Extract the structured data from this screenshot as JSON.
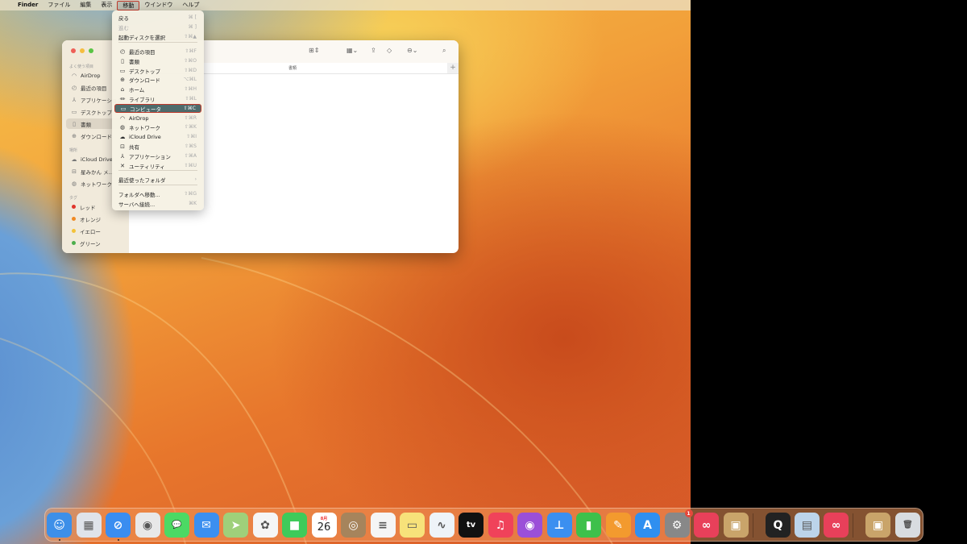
{
  "menubar": {
    "apple": "",
    "app": "Finder",
    "items": [
      "ファイル",
      "編集",
      "表示",
      "移動",
      "ウインドウ",
      "ヘルプ"
    ],
    "active": "移動"
  },
  "menu": {
    "items": [
      {
        "label": "戻る",
        "shortcut": "⌘ [",
        "icon": "",
        "disabled": false
      },
      {
        "label": "進む",
        "shortcut": "⌘ ]",
        "icon": "",
        "disabled": true
      },
      {
        "label": "起動ディスクを選択",
        "shortcut": "⇧⌘▲",
        "icon": "",
        "disabled": false
      },
      {
        "label": "最近の項目",
        "shortcut": "⇧⌘F",
        "icon": "clock-icon"
      },
      {
        "label": "書類",
        "shortcut": "⇧⌘O",
        "icon": "document-icon"
      },
      {
        "label": "デスクトップ",
        "shortcut": "⇧⌘D",
        "icon": "desktop-icon"
      },
      {
        "label": "ダウンロード",
        "shortcut": "⌥⌘L",
        "icon": "download-icon"
      },
      {
        "label": "ホーム",
        "shortcut": "⇧⌘H",
        "icon": "home-icon"
      },
      {
        "label": "ライブラリ",
        "shortcut": "⇧⌘L",
        "icon": "library-icon"
      },
      {
        "label": "コンピュータ",
        "shortcut": "⇧⌘C",
        "icon": "computer-icon",
        "highlighted": true
      },
      {
        "label": "AirDrop",
        "shortcut": "⇧⌘R",
        "icon": "airdrop-icon"
      },
      {
        "label": "ネットワーク",
        "shortcut": "⇧⌘K",
        "icon": "network-icon"
      },
      {
        "label": "iCloud Drive",
        "shortcut": "⇧⌘I",
        "icon": "cloud-icon"
      },
      {
        "label": "共有",
        "shortcut": "⇧⌘S",
        "icon": "shared-folder-icon"
      },
      {
        "label": "アプリケーション",
        "shortcut": "⇧⌘A",
        "icon": "applications-icon"
      },
      {
        "label": "ユーティリティ",
        "shortcut": "⇧⌘U",
        "icon": "utilities-icon"
      },
      {
        "label": "最近使ったフォルダ",
        "shortcut": "›",
        "icon": ""
      },
      {
        "label": "フォルダへ移動...",
        "shortcut": "⇧⌘G",
        "icon": ""
      },
      {
        "label": "サーバへ接続...",
        "shortcut": "⌘K",
        "icon": ""
      }
    ]
  },
  "finder": {
    "column_header": "書類",
    "sidebar": {
      "favorites_title": "よく使う項目",
      "favorites": [
        "AirDrop",
        "最近の項目",
        "アプリケーション",
        "デスクトップ",
        "書類",
        "ダウンロード"
      ],
      "selected": "書類",
      "locations_title": "場所",
      "locations": [
        "iCloud Drive",
        "星みかん メ…",
        "ネットワーク"
      ],
      "tags_title": "タグ",
      "tags": [
        {
          "label": "レッド",
          "color": "#e0352b"
        },
        {
          "label": "オレンジ",
          "color": "#f08a24"
        },
        {
          "label": "イエロー",
          "color": "#f3c23a"
        },
        {
          "label": "グリーン",
          "color": "#4cae4c"
        }
      ]
    }
  },
  "dock": {
    "apps": [
      {
        "name": "Finder",
        "color": "#3d8fe8",
        "glyph": "☺",
        "running": true
      },
      {
        "name": "Launchpad",
        "color": "#dfe3ea",
        "glyph": "▦"
      },
      {
        "name": "Safari",
        "color": "#3a8df0",
        "glyph": "⊘",
        "running": true
      },
      {
        "name": "Chrome",
        "color": "#e8e8e8",
        "glyph": "◉"
      },
      {
        "name": "Messages",
        "color": "#4cd964",
        "glyph": "💬"
      },
      {
        "name": "Mail",
        "color": "#3b8ff0",
        "glyph": "✉"
      },
      {
        "name": "Maps",
        "color": "#9fd07a",
        "glyph": "➤"
      },
      {
        "name": "Photos",
        "color": "#f5f5f5",
        "glyph": "✿"
      },
      {
        "name": "FaceTime",
        "color": "#3ecb5a",
        "glyph": "■"
      },
      {
        "name": "Calendar",
        "color": "#ffffff",
        "glyph": "26",
        "month": "8月"
      },
      {
        "name": "Contacts",
        "color": "#a6845c",
        "glyph": "◎"
      },
      {
        "name": "Reminders",
        "color": "#f5f5f5",
        "glyph": "≡"
      },
      {
        "name": "Notes",
        "color": "#f7e27a",
        "glyph": "▭"
      },
      {
        "name": "Freeform",
        "color": "#eef3f8",
        "glyph": "∿"
      },
      {
        "name": "TV",
        "color": "#111111",
        "glyph": "tv"
      },
      {
        "name": "Music",
        "color": "#f0425a",
        "glyph": "♫"
      },
      {
        "name": "Podcasts",
        "color": "#9b4fd8",
        "glyph": "◉"
      },
      {
        "name": "Keynote",
        "color": "#3b8ff0",
        "glyph": "⊥"
      },
      {
        "name": "Numbers",
        "color": "#3ec04b",
        "glyph": "▮"
      },
      {
        "name": "Pages",
        "color": "#f39a2e",
        "glyph": "✎"
      },
      {
        "name": "App Store",
        "color": "#2f8ff0",
        "glyph": "A"
      },
      {
        "name": "System Settings",
        "color": "#888888",
        "glyph": "⚙",
        "badge": "1"
      },
      {
        "name": "Creative Cloud",
        "color": "#e8405a",
        "glyph": "∞"
      },
      {
        "name": "Archive Utility",
        "color": "#c9a46a",
        "glyph": "▣"
      },
      {
        "name": "QuickTime Player",
        "color": "#222222",
        "glyph": "Q"
      },
      {
        "name": "Preview",
        "color": "#bcd4ea",
        "glyph": "▤"
      },
      {
        "name": "Creative Cloud",
        "color": "#e8405a",
        "glyph": "∞"
      },
      {
        "name": "Archive",
        "color": "#c9a46a",
        "glyph": "▣"
      },
      {
        "name": "Trash",
        "color": "#d8dce0",
        "glyph": "🗑"
      }
    ]
  }
}
